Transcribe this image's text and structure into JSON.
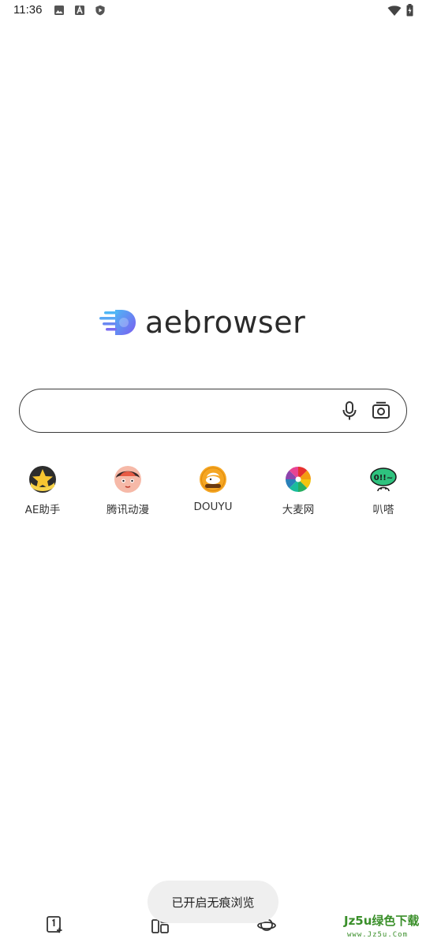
{
  "status_bar": {
    "time": "11:36",
    "left_icons": [
      "image-icon",
      "a-square-icon",
      "shield-play-icon"
    ],
    "right_icons": [
      "wifi-icon",
      "battery-charging-icon"
    ]
  },
  "logo": {
    "text": "aebrowser",
    "colors": {
      "mark_start": "#4fb6f5",
      "mark_end": "#7b5cf0",
      "text": "#2b2b2b"
    }
  },
  "search": {
    "value": "",
    "placeholder": "",
    "mic_icon": "microphone-icon",
    "camera_icon": "camera-scan-icon"
  },
  "shortcuts": [
    {
      "label": "AE助手",
      "icon": "ae-assistant-icon"
    },
    {
      "label": "腾讯动漫",
      "icon": "tencent-comic-icon"
    },
    {
      "label": "DOUYU",
      "icon": "douyu-icon"
    },
    {
      "label": "大麦网",
      "icon": "damai-icon"
    },
    {
      "label": "叭嗒",
      "icon": "bada-icon"
    }
  ],
  "toast": {
    "text": "已开启无痕浏览"
  },
  "bottom_bar": {
    "icons": [
      "new-tab-icon",
      "tabs-icon",
      "planet-icon"
    ]
  },
  "watermark": {
    "main": "Jz5u绿色下载",
    "sub": "www.Jz5u.Com"
  }
}
